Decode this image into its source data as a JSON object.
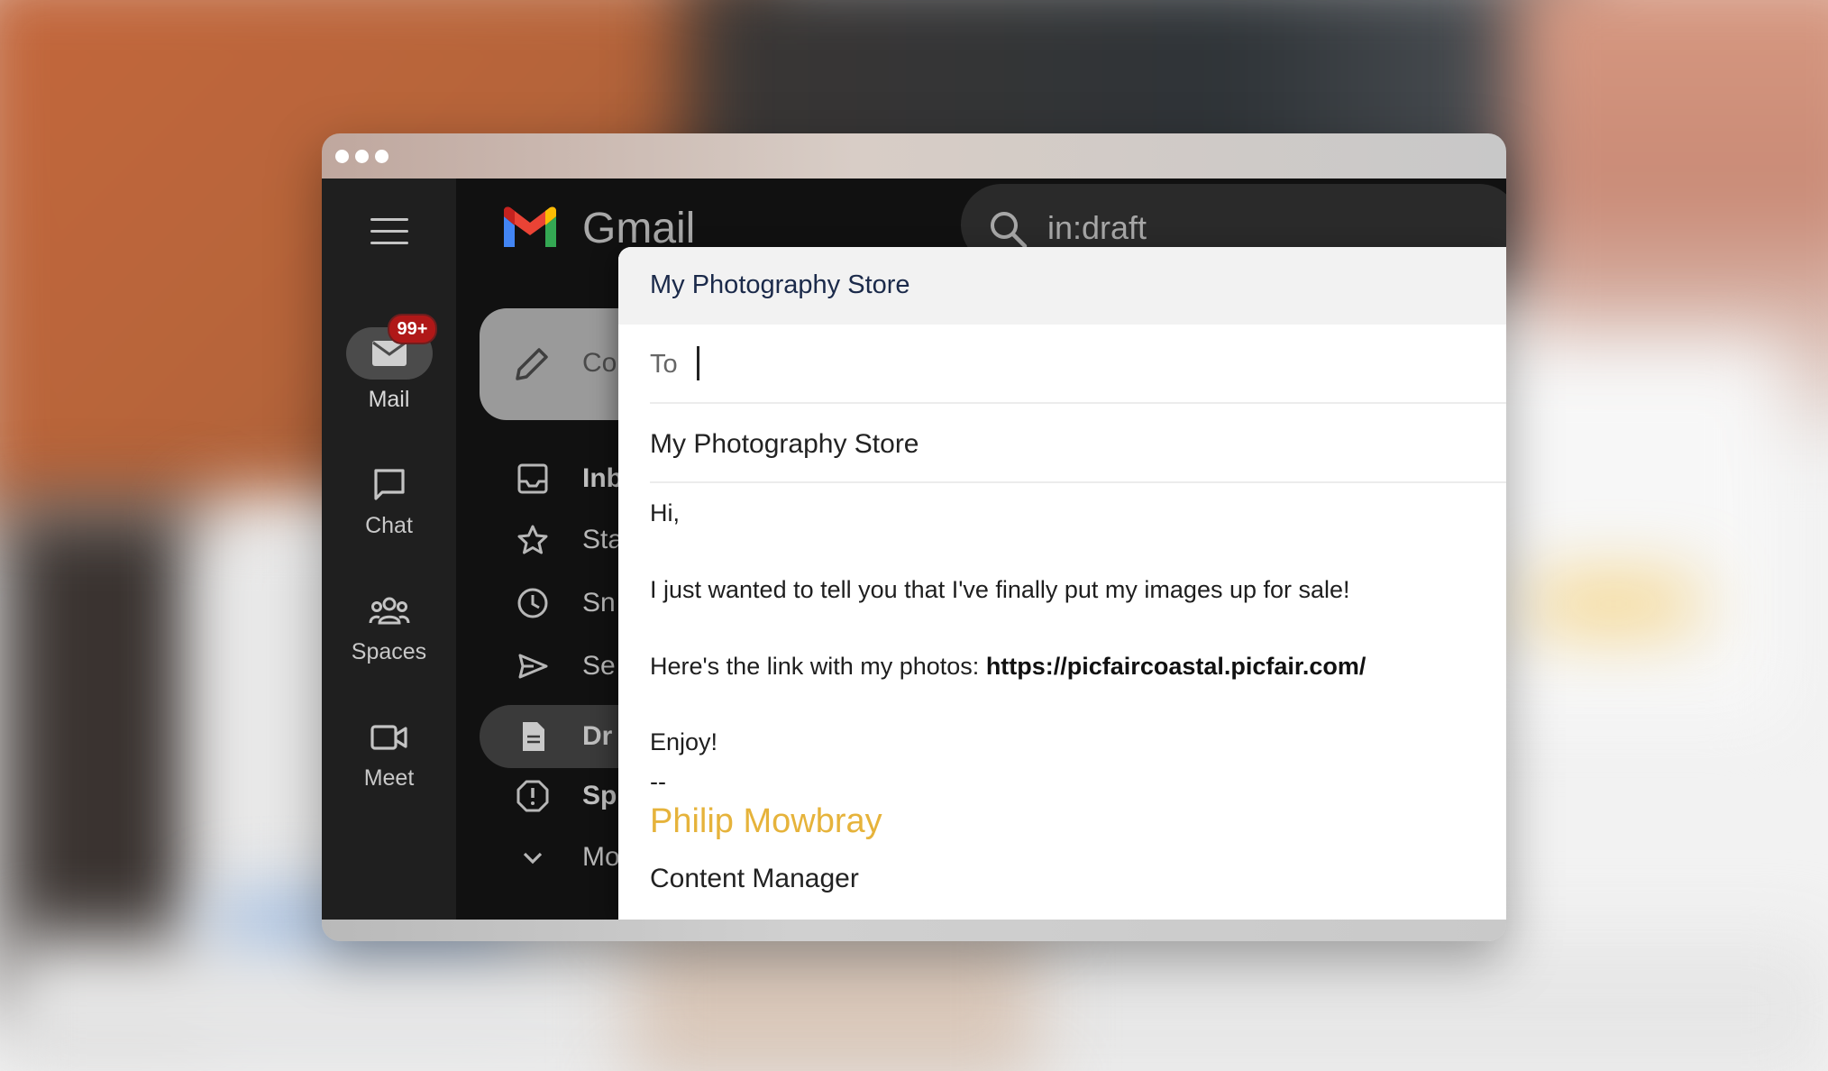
{
  "app": {
    "brand": "Gmail"
  },
  "rail": {
    "items": [
      {
        "label": "Mail",
        "icon": "mail-icon",
        "badge": "99+"
      },
      {
        "label": "Chat",
        "icon": "chat-icon"
      },
      {
        "label": "Spaces",
        "icon": "spaces-icon"
      },
      {
        "label": "Meet",
        "icon": "meet-icon"
      }
    ]
  },
  "search": {
    "value": "in:draft"
  },
  "compose_button": {
    "label": "Co"
  },
  "nav": {
    "items": [
      {
        "label": "Inb",
        "icon": "inbox-icon",
        "bold": true
      },
      {
        "label": "Sta",
        "icon": "star-icon"
      },
      {
        "label": "Sn",
        "icon": "clock-icon"
      },
      {
        "label": "Se",
        "icon": "send-icon"
      },
      {
        "label": "Dr",
        "icon": "draft-icon",
        "bold": true,
        "active": true
      },
      {
        "label": "Sp",
        "icon": "spam-icon",
        "bold": true
      },
      {
        "label": "Mo",
        "icon": "chevron-down-icon"
      }
    ]
  },
  "compose": {
    "window_title": "My Photography Store",
    "to_label": "To",
    "to_value": "",
    "subject": "My Photography Store",
    "body": {
      "greeting": "Hi,",
      "line1": "I just wanted to tell you that I've finally put my images up for sale!",
      "line2_prefix": "Here's the link with my photos: ",
      "link": "https://picfaircoastal.picfair.com/",
      "closing": "Enjoy!",
      "separator": "--",
      "signature_name": "Philip Mowbray",
      "signature_title": "Content Manager"
    }
  },
  "colors": {
    "signature": "#e6b33b",
    "badge": "#b01818",
    "dialog_title": "#1b2a4a"
  }
}
